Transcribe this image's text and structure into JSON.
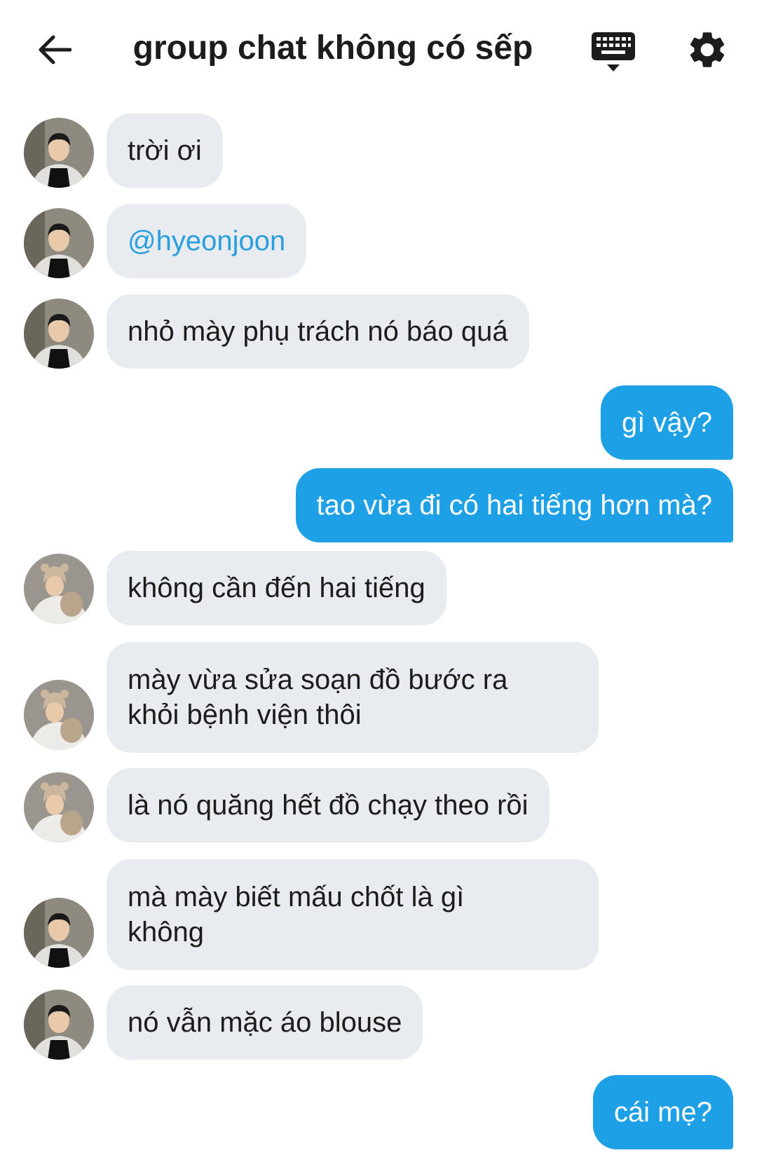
{
  "header": {
    "title": "group chat không có sếp",
    "back_icon": "arrow-left-icon",
    "keyboard_icon": "keyboard-icon",
    "settings_icon": "gear-icon"
  },
  "colors": {
    "incoming_bubble": "#e8ebef",
    "outgoing_bubble": "#1ea0e6",
    "mention": "#2a9fde"
  },
  "messages": [
    {
      "from": "other",
      "text": "trời ơi"
    },
    {
      "from": "other",
      "text": "@hyeonjoon",
      "mention": true
    },
    {
      "from": "other",
      "text": "nhỏ mày phụ trách nó báo quá"
    },
    {
      "from": "me",
      "text": "gì vậy?"
    },
    {
      "from": "me",
      "text": "tao vừa đi có hai tiếng hơn mà?"
    },
    {
      "from": "other",
      "text": "không cần đến hai tiếng"
    },
    {
      "from": "other",
      "text": "mày vừa sửa soạn đồ bước ra\nkhỏi bệnh viện thôi"
    },
    {
      "from": "other",
      "text": "là nó quăng hết đồ chạy theo rồi"
    },
    {
      "from": "other",
      "text": "mà mày biết mấu chốt là gì\nkhông"
    },
    {
      "from": "other",
      "text": "nó vẫn mặc áo blouse"
    },
    {
      "from": "me",
      "text": "cái mẹ?"
    }
  ]
}
